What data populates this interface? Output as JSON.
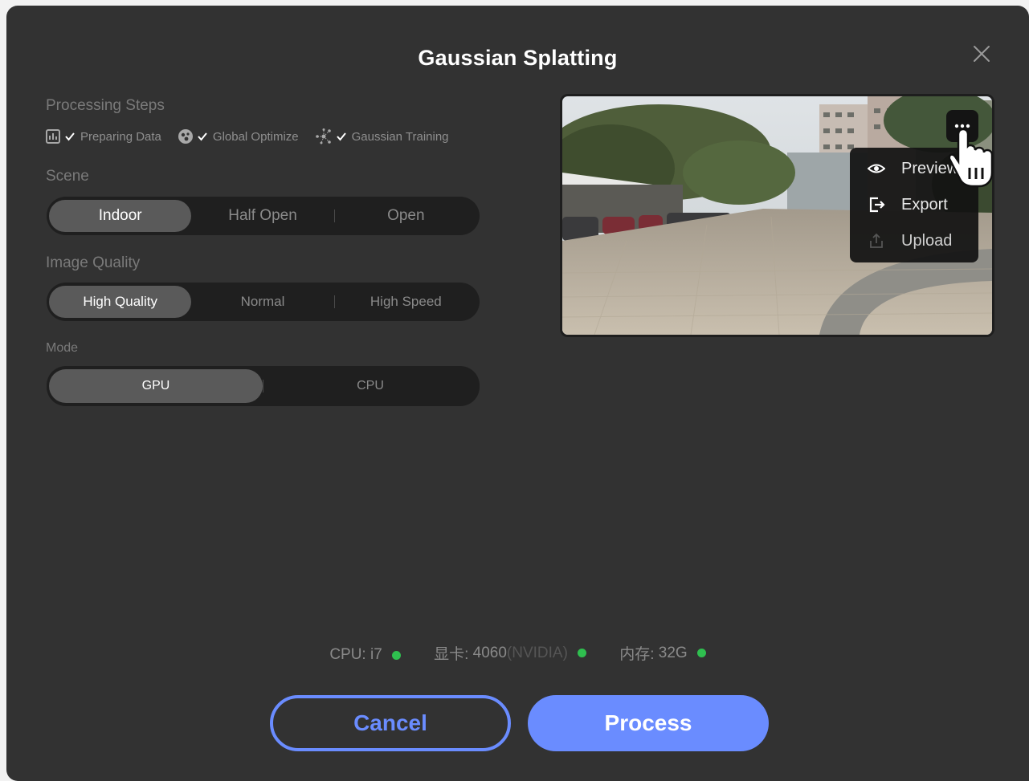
{
  "dialog": {
    "title": "Gaussian Splatting",
    "close_icon": "close-icon"
  },
  "processing_steps": {
    "label": "Processing Steps",
    "steps": [
      {
        "icon": "chart-icon",
        "checked": true,
        "label": "Preparing Data"
      },
      {
        "icon": "globe-icon",
        "checked": true,
        "label": "Global Optimize"
      },
      {
        "icon": "network-icon",
        "checked": true,
        "label": "Gaussian Training"
      }
    ]
  },
  "scene": {
    "label": "Scene",
    "options": [
      "Indoor",
      "Half Open",
      "Open"
    ],
    "selected": "Indoor"
  },
  "image_quality": {
    "label": "Image Quality",
    "options": [
      "High Quality",
      "Normal",
      "High Speed"
    ],
    "selected": "High Quality"
  },
  "mode": {
    "label": "Mode",
    "options": [
      "GPU",
      "CPU"
    ],
    "selected": "GPU"
  },
  "preview": {
    "more_icon": "more-dots-icon",
    "menu": [
      {
        "icon": "eye-icon",
        "label": "Preview"
      },
      {
        "icon": "export-icon",
        "label": "Export"
      },
      {
        "icon": "upload-icon",
        "label": "Upload",
        "disabled": true
      }
    ]
  },
  "system_status": {
    "cpu_label": "CPU:",
    "cpu_value": "i7",
    "gpu_label": "显卡:",
    "gpu_value": "4060",
    "gpu_vendor": "(NVIDIA)",
    "mem_label": "内存:",
    "mem_value": "32G",
    "ok_color": "#2fbf4f"
  },
  "actions": {
    "cancel_label": "Cancel",
    "process_label": "Process",
    "accent_color": "#6a8cff"
  }
}
